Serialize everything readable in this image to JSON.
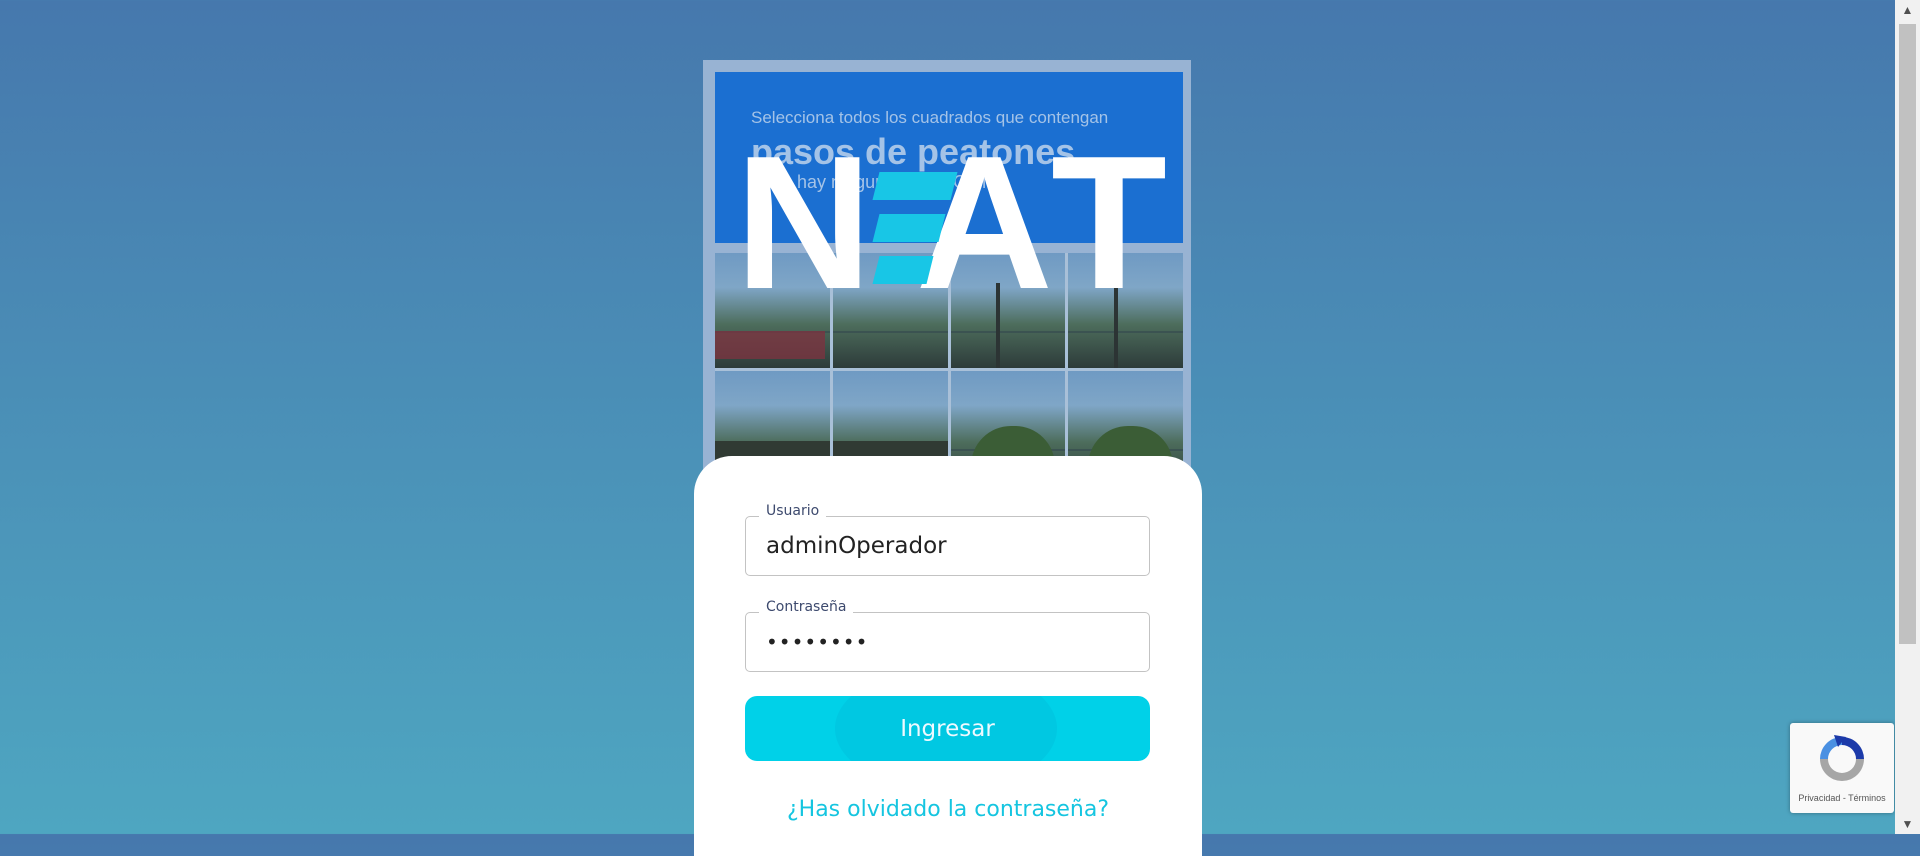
{
  "captcha": {
    "instruction": "Selecciona todos los cuadrados que contengan",
    "target": "pasos de peatones",
    "hint": "Si no hay ninguno, pulsa Omitir"
  },
  "logo": {
    "letter_n": "N",
    "letter_a": "A",
    "letter_t": "T"
  },
  "login": {
    "username_label": "Usuario",
    "username_value": "adminOperador",
    "password_label": "Contraseña",
    "password_value": "••••••••",
    "submit_label": "Ingresar",
    "forgot_link": "¿Has olvidado la contraseña?"
  },
  "recaptcha_badge": {
    "text": "Privacidad - Términos",
    "icon": "recaptcha-icon"
  },
  "colors": {
    "accent": "#00d1e8",
    "captcha_header": "#1b6fd1",
    "logo_mark": "#18c6e6"
  }
}
